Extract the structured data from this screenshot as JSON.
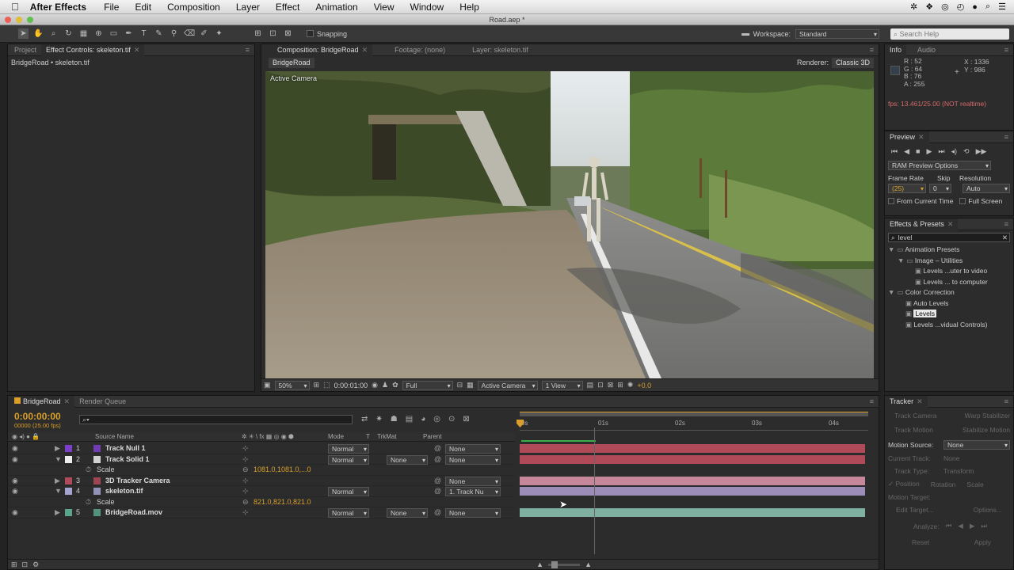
{
  "menubar": {
    "apple": "",
    "app_name": "After Effects",
    "items": [
      "File",
      "Edit",
      "Composition",
      "Layer",
      "Effect",
      "Animation",
      "View",
      "Window",
      "Help"
    ]
  },
  "window": {
    "title": "Road.aep *"
  },
  "toolbar": {
    "snapping": "Snapping",
    "workspace_label": "Workspace:",
    "workspace_value": "Standard",
    "search_placeholder": "Search Help"
  },
  "project_panel": {
    "tab_project": "Project",
    "tab_effect_controls": "Effect Controls: skeleton.tif",
    "breadcrumb": "BridgeRoad • skeleton.tif"
  },
  "viewer": {
    "tab_composition": "Composition: BridgeRoad",
    "tab_footage": "Footage: (none)",
    "tab_layer": "Layer: skeleton.tif",
    "comp_chip": "BridgeRoad",
    "renderer_label": "Renderer:",
    "renderer_value": "Classic 3D",
    "camera_label": "Active Camera",
    "zoom": "50%",
    "timecode": "0:00:01:00",
    "resolution": "Full",
    "view_camera": "Active Camera",
    "views": "1 View",
    "exposure": "+0.0"
  },
  "info": {
    "tab": "Info",
    "tab_audio": "Audio",
    "r": "R : 52",
    "g": "G : 64",
    "b": "B : 76",
    "a": "A : 255",
    "x": "X : 1336",
    "y": "Y : 986",
    "fps": "fps: 13.461/25.00 (NOT realtime)",
    "swatch_color": "#34404c"
  },
  "preview": {
    "tab": "Preview",
    "ram_options": "RAM Preview Options",
    "frame_rate_label": "Frame Rate",
    "skip_label": "Skip",
    "resolution_label": "Resolution",
    "frame_rate": "(25)",
    "skip": "0",
    "resolution": "Auto",
    "from_current": "From Current Time",
    "full_screen": "Full Screen"
  },
  "effects": {
    "tab": "Effects & Presets",
    "search": "level",
    "tree": [
      {
        "depth": 0,
        "text": "Animation Presets",
        "twirl": "▼"
      },
      {
        "depth": 1,
        "text": "Image – Utilities",
        "twirl": "▼"
      },
      {
        "depth": 2,
        "text": "Levels ...uter to video",
        "twirl": ""
      },
      {
        "depth": 2,
        "text": "Levels ... to computer",
        "twirl": ""
      },
      {
        "depth": 0,
        "text": "Color Correction",
        "twirl": "▼"
      },
      {
        "depth": 1,
        "text": "Auto Levels",
        "twirl": ""
      },
      {
        "depth": 1,
        "text": "Levels",
        "twirl": "",
        "selected": true
      },
      {
        "depth": 1,
        "text": "Levels ...vidual Controls)",
        "twirl": ""
      }
    ]
  },
  "timeline": {
    "tab": "BridgeRoad",
    "tab_render": "Render Queue",
    "timecode": "0:00:00:00",
    "subframe": "00000 (25.00 fps)",
    "headers": {
      "source": "Source Name",
      "mode": "Mode",
      "t": "T",
      "trkmat": "TrkMat",
      "parent": "Parent"
    },
    "ruler": [
      "0s",
      "01s",
      "02s",
      "03s",
      "04s"
    ],
    "layers": [
      {
        "num": "1",
        "name": "Track Null 1",
        "label": "#7b3fc9",
        "mode": "Normal",
        "trkmat": "",
        "parent": "None",
        "bar": "#b14a58",
        "kind": "layer"
      },
      {
        "num": "2",
        "name": "Track Solid 1",
        "label": "#eeeeee",
        "mode": "Normal",
        "trkmat": "None",
        "parent": "None",
        "bar": "#b14a58",
        "kind": "layer"
      },
      {
        "num": "",
        "name": "Scale",
        "value": "1081.0,1081.0,...0",
        "kind": "prop"
      },
      {
        "num": "3",
        "name": "3D Tracker Camera",
        "label": "#b04a5a",
        "mode": "",
        "trkmat": "",
        "parent": "None",
        "bar": "#c7879b",
        "kind": "layer"
      },
      {
        "num": "4",
        "name": "skeleton.tif",
        "label": "#a4a4cf",
        "mode": "Normal",
        "trkmat": "",
        "parent": "1. Track Nu",
        "bar": "#9c8cb8",
        "kind": "layer"
      },
      {
        "num": "",
        "name": "Scale",
        "value": "821.0,821.0,821.0",
        "kind": "prop"
      },
      {
        "num": "5",
        "name": "BridgeRoad.mov",
        "label": "#5aa48e",
        "mode": "Normal",
        "trkmat": "None",
        "parent": "None",
        "bar": "#7fb0a2",
        "kind": "layer"
      }
    ]
  },
  "tracker": {
    "tab": "Tracker",
    "track_camera": "Track Camera",
    "warp_stabilizer": "Warp Stabilizer",
    "track_motion": "Track Motion",
    "stabilize_motion": "Stabilize Motion",
    "motion_source_label": "Motion Source:",
    "motion_source": "None",
    "current_track_label": "Current Track:",
    "current_track": "None",
    "track_type_label": "Track Type:",
    "track_type": "Transform",
    "position": "Position",
    "rotation": "Rotation",
    "scale": "Scale",
    "motion_target": "Motion Target:",
    "edit_target": "Edit Target...",
    "options": "Options...",
    "analyze": "Analyze:",
    "reset": "Reset",
    "apply": "Apply"
  }
}
